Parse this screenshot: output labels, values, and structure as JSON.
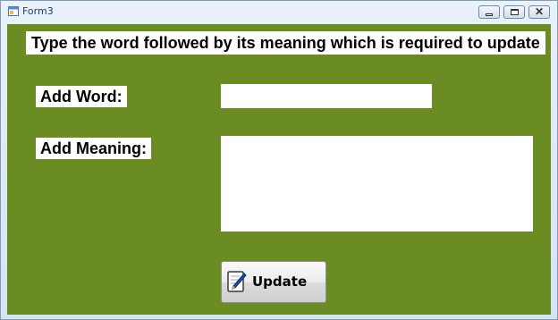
{
  "window": {
    "title": "Form3"
  },
  "form": {
    "heading": "Type the word followed by its meaning which is required to update",
    "word_label": "Add Word:",
    "meaning_label": "Add Meaning:",
    "word_value": "",
    "meaning_value": "",
    "update_button_label": "Update"
  },
  "colors": {
    "background": "#6b8b23",
    "label_background": "#ffffff"
  },
  "icons": {
    "app": "form-icon",
    "update": "notepad-pen-icon",
    "minimize": "minimize-icon",
    "maximize": "maximize-icon",
    "close": "close-icon"
  }
}
